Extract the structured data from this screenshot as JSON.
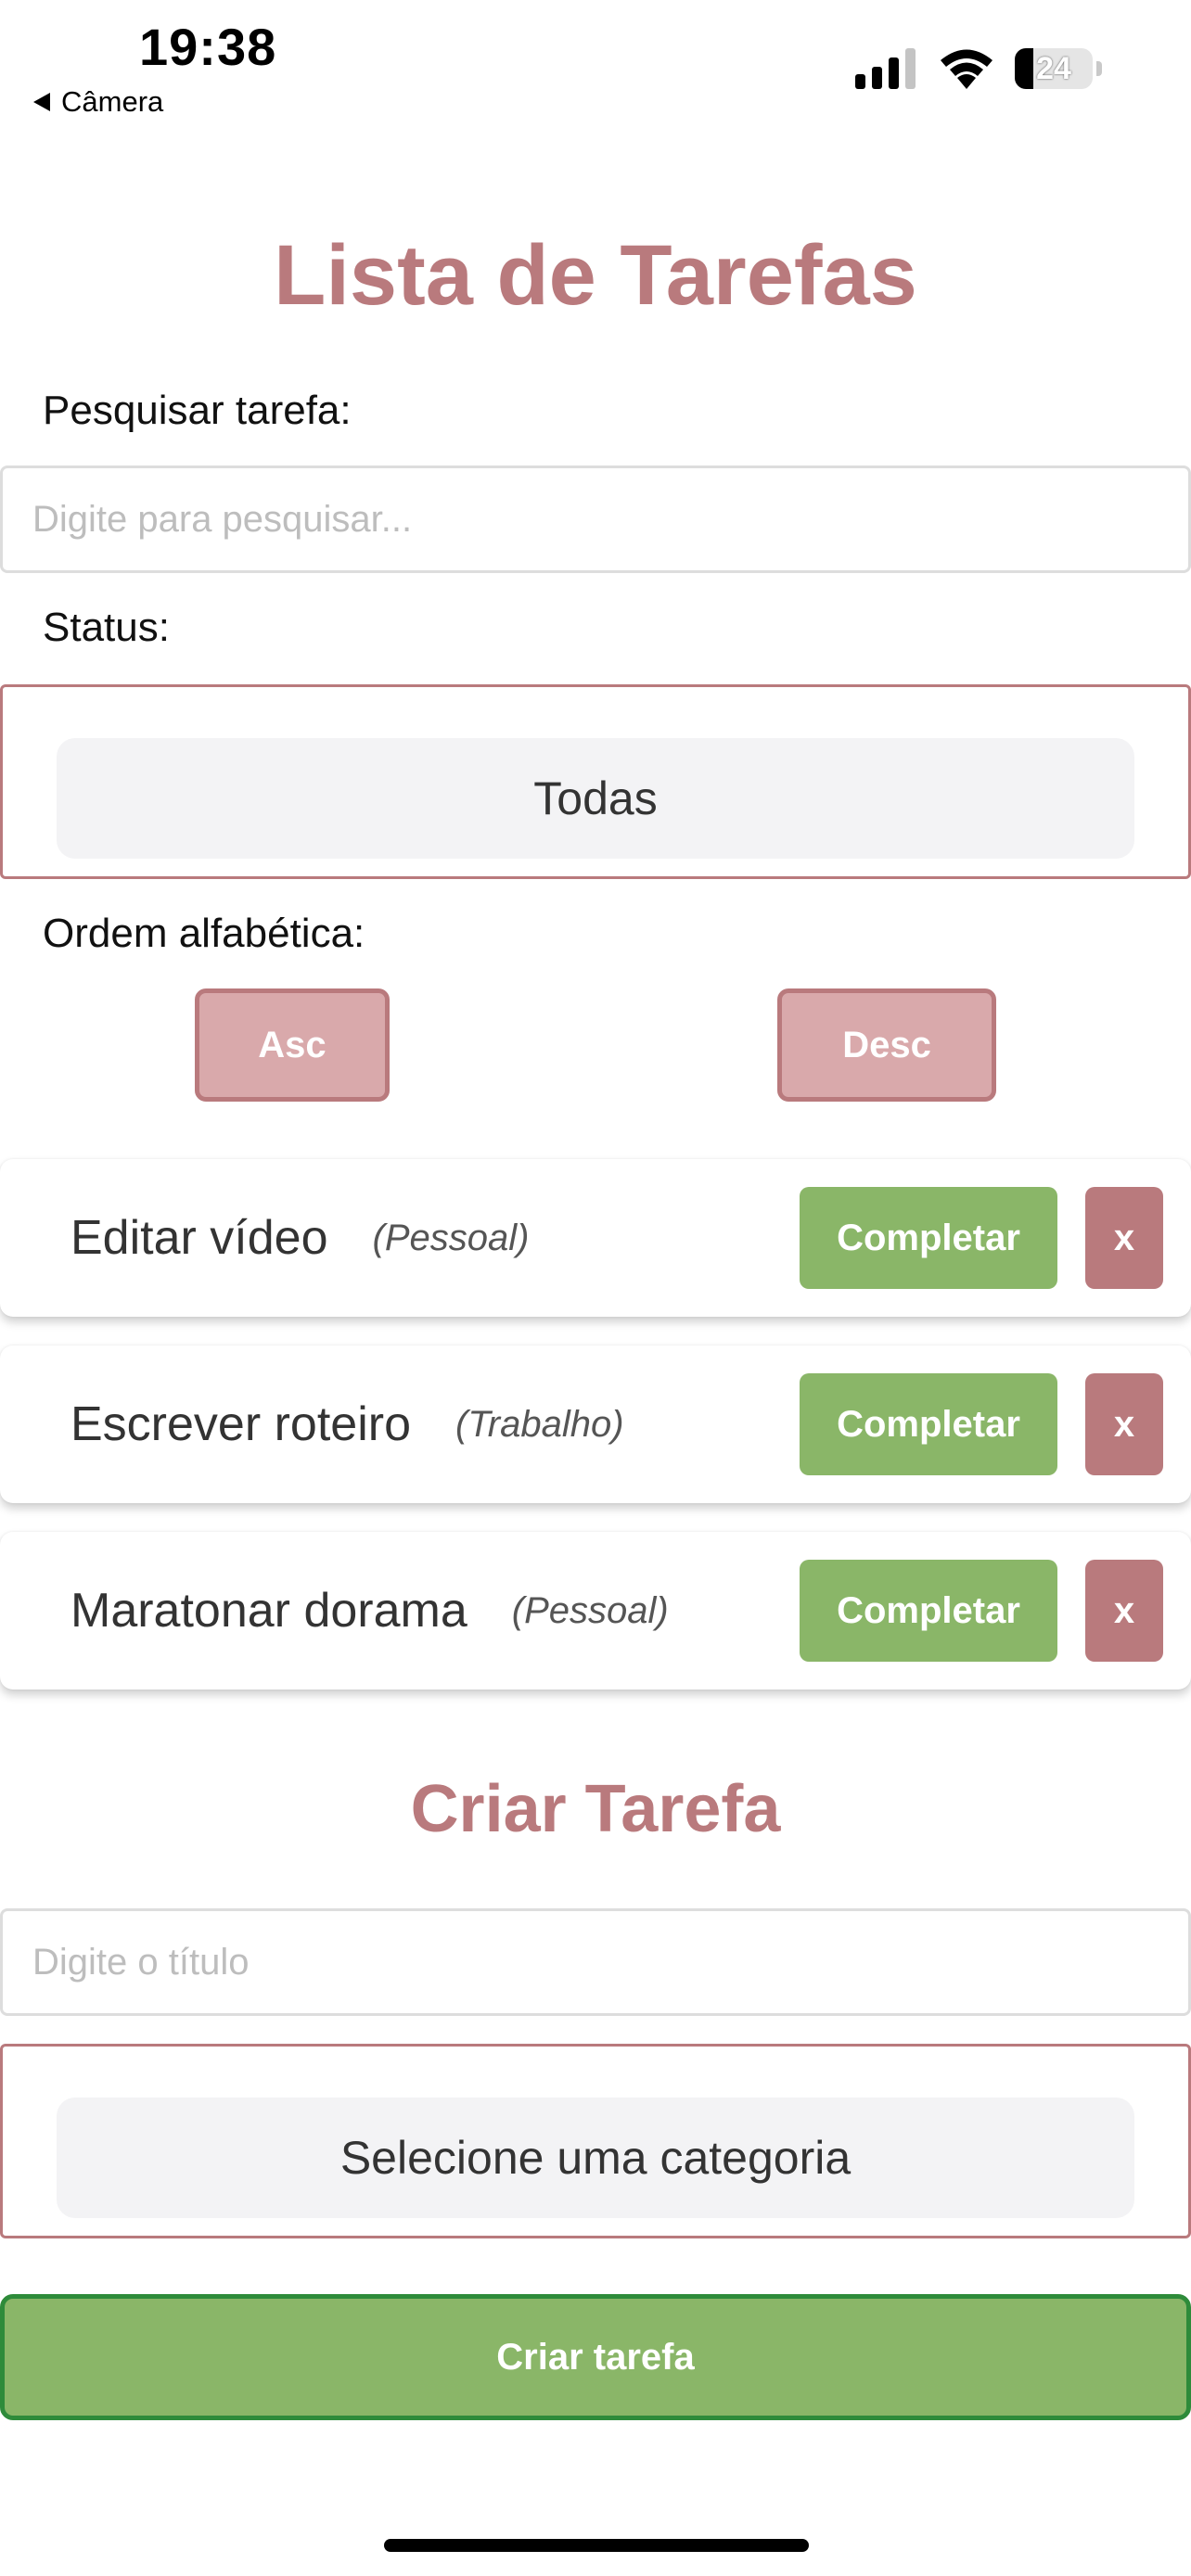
{
  "status_bar": {
    "time": "19:38",
    "back_label": "Câmera",
    "battery_text": "24",
    "battery_level_percent": 24
  },
  "header": {
    "title": "Lista de Tarefas"
  },
  "search": {
    "label": "Pesquisar tarefa:",
    "placeholder": "Digite para pesquisar...",
    "value": ""
  },
  "status_filter": {
    "label": "Status:",
    "selected": "Todas"
  },
  "sort": {
    "label": "Ordem alfabética:",
    "asc_label": "Asc",
    "desc_label": "Desc"
  },
  "tasks": [
    {
      "title": "Editar vídeo",
      "category": "(Pessoal)",
      "complete_label": "Completar",
      "delete_label": "x"
    },
    {
      "title": "Escrever roteiro",
      "category": "(Trabalho)",
      "complete_label": "Completar",
      "delete_label": "x"
    },
    {
      "title": "Maratonar dorama",
      "category": "(Pessoal)",
      "complete_label": "Completar",
      "delete_label": "x"
    }
  ],
  "create": {
    "title": "Criar Tarefa",
    "title_placeholder": "Digite o título",
    "category_selected": "Selecione uma categoria",
    "submit_label": "Criar tarefa"
  },
  "colors": {
    "accent": "#b97a7d",
    "accent_light": "#d9a9ab",
    "success": "#8ab668",
    "success_border": "#2e8b3a"
  },
  "icons": [
    "back-triangle-icon",
    "cellular-signal-icon",
    "wifi-icon",
    "battery-icon"
  ]
}
